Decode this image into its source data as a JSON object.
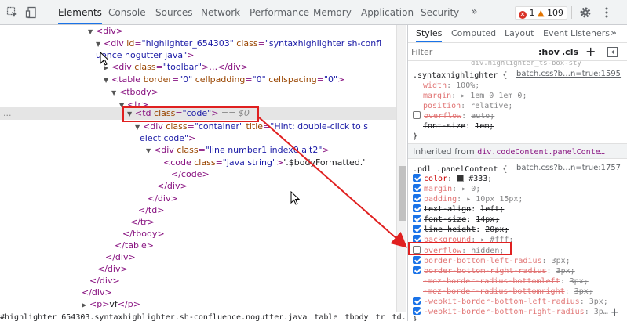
{
  "toolbar": {
    "inspect_icon": "cursor-select-icon",
    "device_icon": "device-toggle-icon",
    "tabs": [
      "Elements",
      "Console",
      "Sources",
      "Network",
      "Performance",
      "Memory",
      "Application",
      "Security"
    ],
    "more": "»",
    "errors": "1",
    "warnings": "109",
    "settings_icon": "gear-icon",
    "menu_icon": "kebab-menu-icon"
  },
  "dom_lines": [
    {
      "d": "  ▼ <div>"
    },
    {
      "d": "  ▼ <div id=\"highlighter_654303\" class=\"syntaxhighlighter sh-confl"
    },
    {
      "d": "uence nogutter  java\">"
    },
    {
      "d": "  ▶ <div class=\"toolbar\">…</div>"
    },
    {
      "d": "  ▼ <table border=\"0\" cellpadding=\"0\" cellspacing=\"0\">"
    },
    {
      "d": "  ▼ <tbody>"
    },
    {
      "d": "  ▼ <tr>"
    },
    {
      "d": "  ▼ <td class=\"code\"> == $0"
    },
    {
      "d": "  ▼ <div class=\"container\" title=\"Hint: double-click to s"
    },
    {
      "d": "elect code\">"
    },
    {
      "d": "  ▼ <div class=\"line number1 index0 alt2\">"
    },
    {
      "d": "<code class=\"java string\">'.$bodyFormatted.'"
    },
    {
      "d": "</code>"
    },
    {
      "d": "</div>"
    },
    {
      "d": "</div>"
    },
    {
      "d": "</td>"
    },
    {
      "d": "</tr>"
    },
    {
      "d": "</tbody>"
    },
    {
      "d": "</table>"
    },
    {
      "d": "</div>"
    },
    {
      "d": "</div>"
    },
    {
      "d": "</div>"
    },
    {
      "d": "</div>"
    },
    {
      "d": "<p>vf</p>"
    }
  ],
  "dom": {
    "l1_tag": "<div>",
    "l2_open": "<div ",
    "l2_an1": "id",
    "l2_av1": "\"highlighter_654303\"",
    "l2_an2": "class",
    "l2_av2": "\"syntaxhighlighter sh-confl",
    "l3_av": "uence nogutter  java\"",
    "l3_close": ">",
    "l4_open": "<div ",
    "l4_an": "class",
    "l4_av": "\"toolbar\"",
    "l4_rest": ">…</div>",
    "l5_open": "<table ",
    "l5_an1": "border",
    "l5_av1": "\"0\"",
    "l5_an2": "cellpadding",
    "l5_av2": "\"0\"",
    "l5_an3": "cellspacing",
    "l5_av3": "\"0\"",
    "l5_close": ">",
    "l6": "<tbody>",
    "l7": "<tr>",
    "l8_open": "<td ",
    "l8_an": "class",
    "l8_av": "\"code\"",
    "l8_close": ">",
    "l8_marker": "== $0",
    "l9_open": "<div ",
    "l9_an1": "class",
    "l9_av1": "\"container\"",
    "l9_an2": "title",
    "l9_av2": "\"Hint: double-click to s",
    "l10_av": "elect code\"",
    "l10_close": ">",
    "l11_open": "<div ",
    "l11_an": "class",
    "l11_av": "\"line number1 index0 alt2\"",
    "l11_close": ">",
    "l12_open": "<code ",
    "l12_an": "class",
    "l12_av": "\"java string\"",
    "l12_close": ">",
    "l12_text": "'.$bodyFormatted.'",
    "l13": "</code>",
    "l14": "</div>",
    "l15": "</div>",
    "l16": "</td>",
    "l17": "</tr>",
    "l18": "</tbody>",
    "l19": "</table>",
    "l20": "</div>",
    "l21": "</div>",
    "l22": "</div>",
    "l23": "</div>",
    "l24_open": "<p>",
    "l24_text": "vf",
    "l24_close": "</p>",
    "ellipsis": "..."
  },
  "breadcrumbs": [
    "#highlighter_654303.syntaxhighlighter.sh-confluence.nogutter.java",
    "table",
    "tbody",
    "tr",
    "td.code"
  ],
  "styles_tabs": [
    "Styles",
    "Computed",
    "Layout",
    "Event Listeners",
    "»"
  ],
  "filter_placeholder": "Filter",
  "hov": ":hov",
  "cls": ".cls",
  "plus": "+",
  "sidebar_icon": "toggle-sidebar-icon",
  "rule1": {
    "cut": "div.highlighter_ts-box-sty",
    "selector": ".syntaxhighlighter {",
    "link": "batch.css?b…n=true:1595",
    "props": [
      {
        "p": "width",
        "v": "100%;"
      },
      {
        "p": "margin",
        "v": "▸ 1em 0 1em 0;"
      },
      {
        "p": "position",
        "v": "relative;"
      },
      {
        "p": "overflow",
        "v": "auto;"
      },
      {
        "p": "font-size",
        "v": "1em;"
      }
    ],
    "close": "}"
  },
  "inherited_label": "Inherited from",
  "inherited_from": "div.codeContent.panelConte…",
  "rule2": {
    "selector": ".pdl .panelContent {",
    "link": "batch.css?b…n=true:1757",
    "props": [
      {
        "p": "color",
        "v": "#333;"
      },
      {
        "p": "margin",
        "v": "▸ 0;"
      },
      {
        "p": "padding",
        "v": "▸ 10px 15px;"
      },
      {
        "p": "text-align",
        "v": "left;"
      },
      {
        "p": "font-size",
        "v": "14px;"
      },
      {
        "p": "line-height",
        "v": "20px;"
      },
      {
        "p": "background",
        "v": "▸ #fff;"
      },
      {
        "p": "overflow",
        "v": "hidden;"
      },
      {
        "p": "border-bottom-left-radius",
        "v": "3px;"
      },
      {
        "p": "border-bottom-right-radius",
        "v": "3px;"
      },
      {
        "p": "-moz-border-radius-bottomleft",
        "v": "3px;"
      },
      {
        "p": "-moz-border-radius-bottomright",
        "v": "3px;"
      },
      {
        "p": "-webkit-border-bottom-left-radius",
        "v": "3px;"
      },
      {
        "p": "-webkit-border-bottom-right-radius",
        "v": "3p…"
      }
    ],
    "close": "}"
  },
  "colors": {
    "highlight_box": "#e02020",
    "accent": "#1a73e8",
    "swatch": "#333333"
  }
}
